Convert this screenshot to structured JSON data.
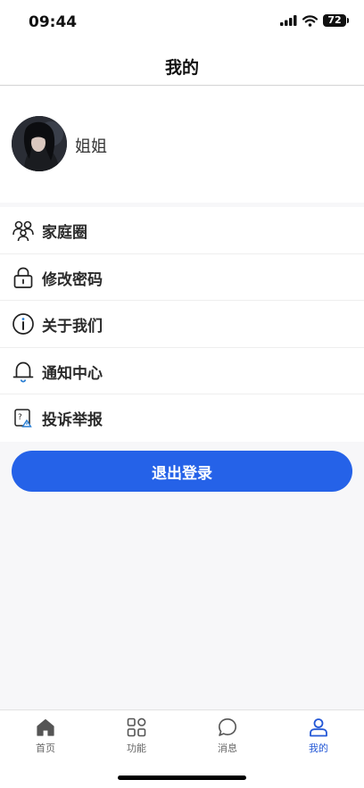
{
  "status_bar": {
    "time": "09:44",
    "battery": "72"
  },
  "header": {
    "title": "我的"
  },
  "profile": {
    "name": "姐姐"
  },
  "menu": {
    "items": [
      {
        "label": "家庭圈",
        "icon": "family-icon"
      },
      {
        "label": "修改密码",
        "icon": "lock-icon"
      },
      {
        "label": "关于我们",
        "icon": "info-icon"
      },
      {
        "label": "通知中心",
        "icon": "bell-icon"
      },
      {
        "label": "投诉举报",
        "icon": "report-icon"
      }
    ]
  },
  "logout": {
    "label": "退出登录"
  },
  "tabs": [
    {
      "label": "首页",
      "icon": "home-icon",
      "active": false
    },
    {
      "label": "功能",
      "icon": "grid-icon",
      "active": false
    },
    {
      "label": "消息",
      "icon": "message-icon",
      "active": false
    },
    {
      "label": "我的",
      "icon": "person-icon",
      "active": true
    }
  ],
  "colors": {
    "accent": "#2562e8",
    "active_tab": "#2458d6",
    "background": "#f7f7f9"
  }
}
